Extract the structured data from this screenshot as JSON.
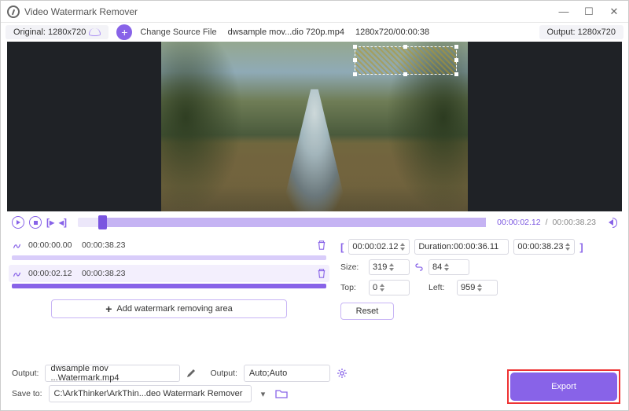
{
  "title": "Video Watermark Remover",
  "header": {
    "original": "Original: 1280x720",
    "change_source": "Change Source File",
    "filename": "dwsample mov...dio 720p.mp4",
    "fileinfo": "1280x720/00:00:38",
    "output": "Output: 1280x720"
  },
  "player": {
    "current": "00:00:02.12",
    "total": "00:00:38.23"
  },
  "segments": [
    {
      "start": "00:00:00.00",
      "end": "00:00:38.23",
      "active": false
    },
    {
      "start": "00:00:02.12",
      "end": "00:00:38.23",
      "active": true
    }
  ],
  "add_area": "Add watermark removing area",
  "range": {
    "start": "00:00:02.12",
    "duration_label": "Duration:00:00:36.11",
    "end": "00:00:38.23"
  },
  "size": {
    "label": "Size:",
    "w": "319",
    "h": "84"
  },
  "pos": {
    "top_label": "Top:",
    "top": "0",
    "left_label": "Left:",
    "left": "959"
  },
  "reset": "Reset",
  "output_row": {
    "label": "Output:",
    "filename": "dwsample mov ...Watermark.mp4",
    "fmt_label": "Output:",
    "fmt": "Auto;Auto"
  },
  "save_row": {
    "label": "Save to:",
    "path": "C:\\ArkThinker\\ArkThin...deo Watermark Remover"
  },
  "export": "Export"
}
